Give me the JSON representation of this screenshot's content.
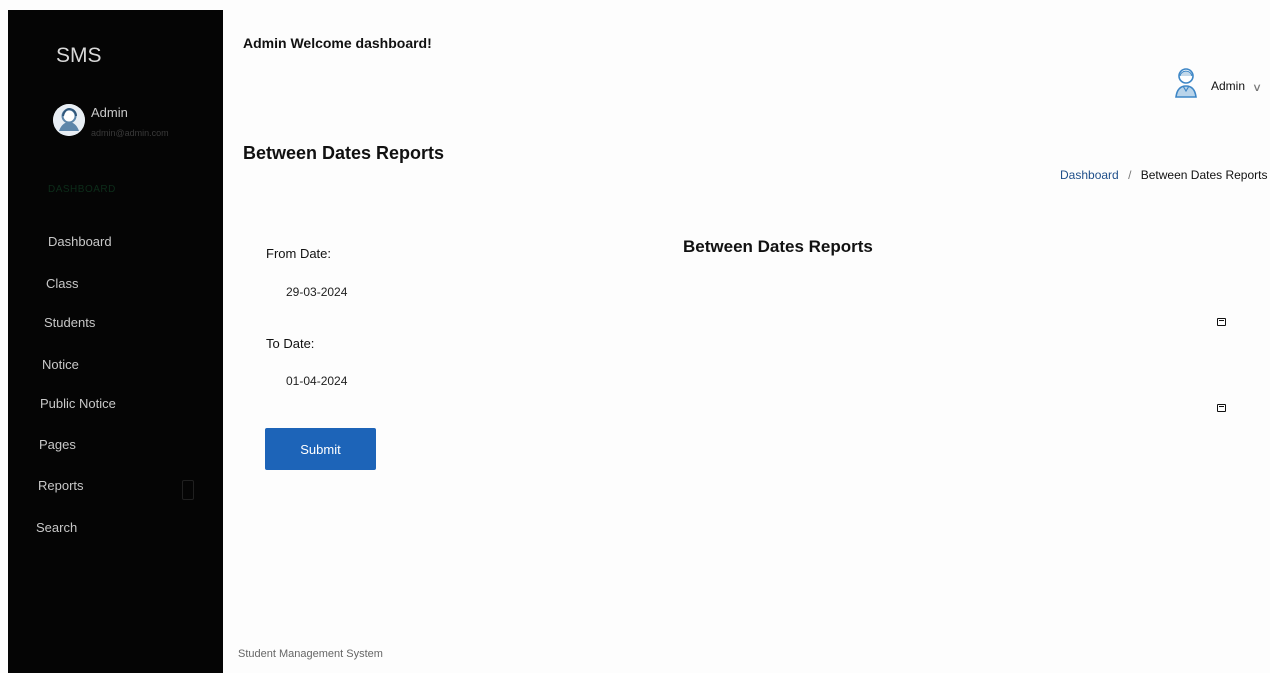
{
  "sidebar": {
    "brand": "SMS",
    "profile_name": "Admin",
    "profile_email": "admin@admin.com",
    "section_title": "DASHBOARD",
    "items": [
      {
        "label": "Dashboard"
      },
      {
        "label": "Class"
      },
      {
        "label": "Students"
      },
      {
        "label": "Notice"
      },
      {
        "label": "Public Notice"
      },
      {
        "label": "Pages"
      },
      {
        "label": "Reports"
      },
      {
        "label": "Search"
      }
    ]
  },
  "topbar": {
    "welcome": "Admin Welcome dashboard!",
    "user_name": "Admin",
    "chevron": "∨"
  },
  "page": {
    "title": "Between Dates Reports",
    "breadcrumb": {
      "link": "Dashboard",
      "separator": "/",
      "current": "Between Dates Reports"
    },
    "form": {
      "heading": "Between Dates Reports",
      "from_label": "From Date:",
      "from_value": "29-03-2024",
      "to_label": "To Date:",
      "to_value": "01-04-2024",
      "submit_label": "Submit"
    },
    "footer": "Student Management System"
  },
  "icons": {
    "avatar": "user-avatar-icon",
    "user_menu": "user-profile-icon",
    "calendar": "calendar-icon",
    "dropdown": "chevron-down-icon"
  },
  "colors": {
    "sidebar_background": "#050505",
    "primary_button": "#1d64b8",
    "breadcrumb_link": "#1f4f8a"
  }
}
